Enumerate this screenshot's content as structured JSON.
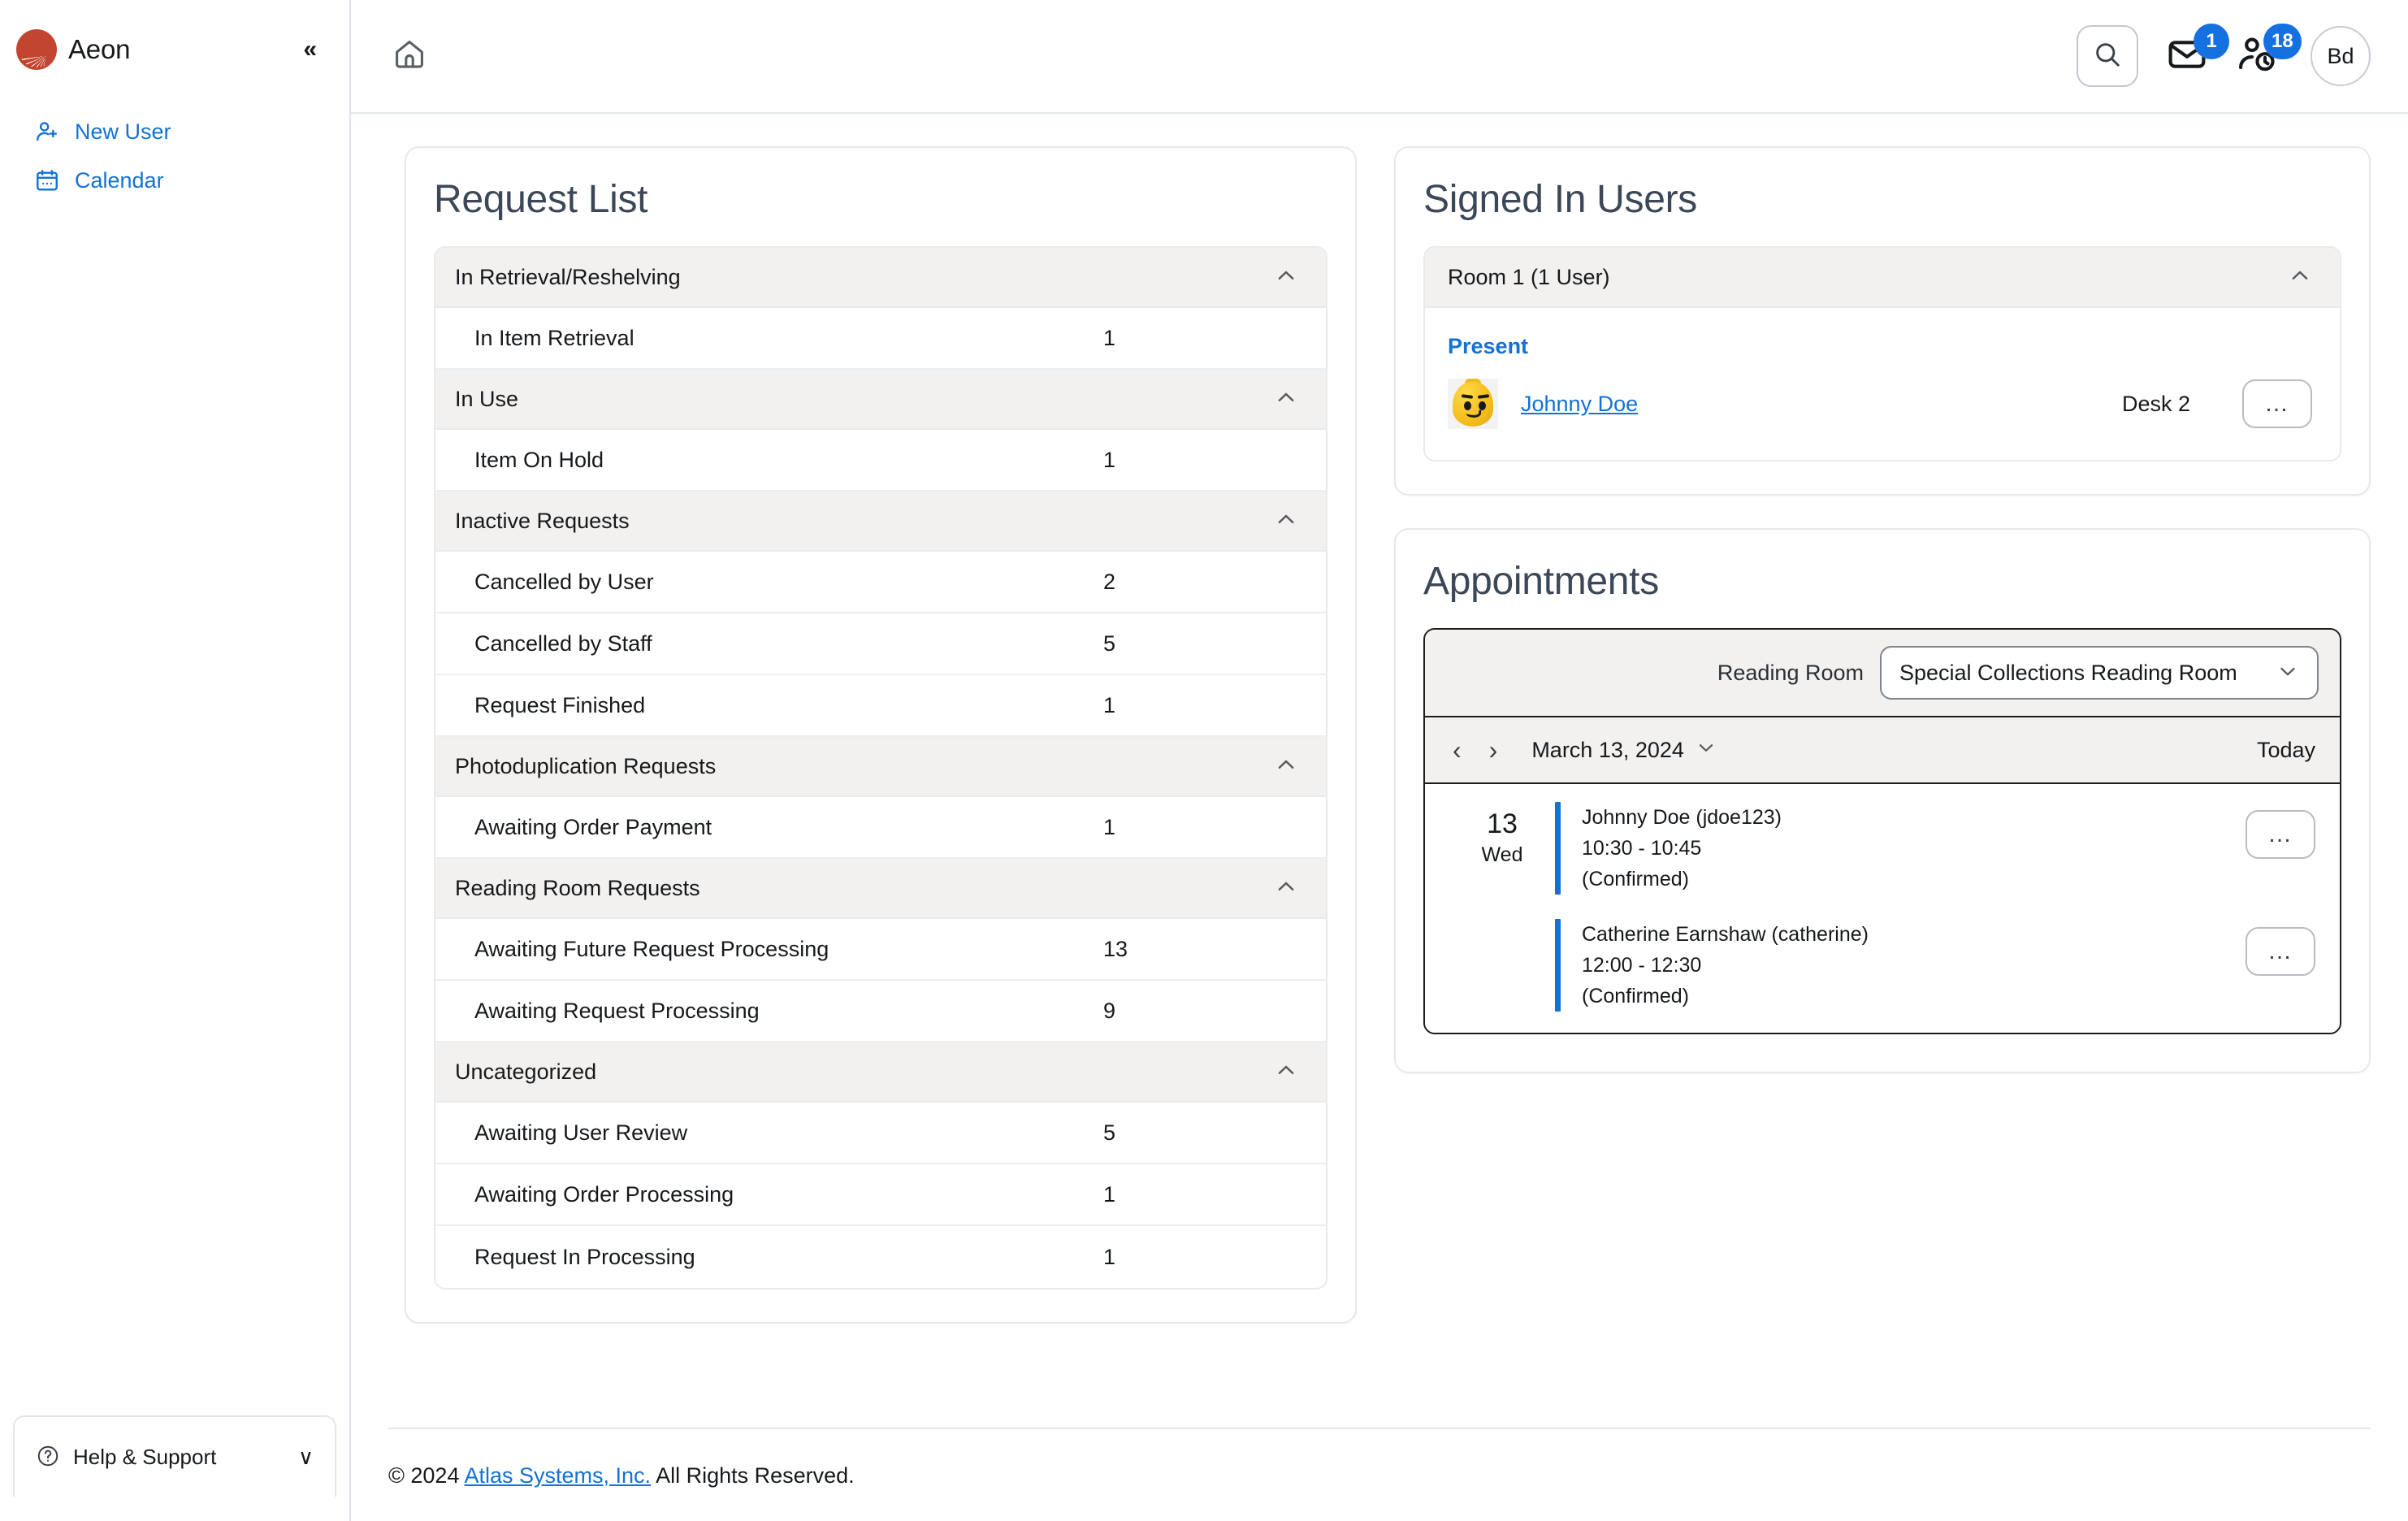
{
  "sidebar": {
    "brand": "Aeon",
    "collapse_label": "«",
    "items": [
      {
        "label": "New User",
        "icon": "user-plus-icon"
      },
      {
        "label": "Calendar",
        "icon": "calendar-icon"
      }
    ],
    "help": {
      "label": "Help & Support",
      "icon": "question-circle-icon",
      "chevron": "∨"
    }
  },
  "topbar": {
    "home_icon": "home-icon",
    "search_icon": "search-icon",
    "mail": {
      "icon": "mail-icon",
      "badge": "1"
    },
    "users_clock": {
      "icon": "users-clock-icon",
      "badge": "18"
    },
    "profile_initials": "Bd"
  },
  "request_list": {
    "title": "Request List",
    "groups": [
      {
        "title": "In Retrieval/Reshelving",
        "expanded": true,
        "rows": [
          {
            "label": "In Item Retrieval",
            "count": "1"
          }
        ]
      },
      {
        "title": "In Use",
        "expanded": true,
        "rows": [
          {
            "label": "Item On Hold",
            "count": "1"
          }
        ]
      },
      {
        "title": "Inactive Requests",
        "expanded": true,
        "rows": [
          {
            "label": "Cancelled by User",
            "count": "2"
          },
          {
            "label": "Cancelled by Staff",
            "count": "5"
          },
          {
            "label": "Request Finished",
            "count": "1"
          }
        ]
      },
      {
        "title": "Photoduplication Requests",
        "expanded": true,
        "rows": [
          {
            "label": "Awaiting Order Payment",
            "count": "1"
          }
        ]
      },
      {
        "title": "Reading Room Requests",
        "expanded": true,
        "rows": [
          {
            "label": "Awaiting Future Request Processing",
            "count": "13"
          },
          {
            "label": "Awaiting Request Processing",
            "count": "9"
          }
        ]
      },
      {
        "title": "Uncategorized",
        "expanded": true,
        "rows": [
          {
            "label": "Awaiting User Review",
            "count": "5"
          },
          {
            "label": "Awaiting Order Processing",
            "count": "1"
          },
          {
            "label": "Request In Processing",
            "count": "1"
          }
        ]
      }
    ]
  },
  "signed_in_users": {
    "title": "Signed In Users",
    "room": {
      "label": "Room 1 (1 User)",
      "expanded": true
    },
    "status": "Present",
    "users": [
      {
        "name": "Johnny Doe",
        "desk": "Desk 2",
        "avatar": "lego-head-avatar",
        "menu": "…"
      }
    ]
  },
  "appointments": {
    "title": "Appointments",
    "filter": {
      "label": "Reading Room",
      "selected": "Special Collections Reading Room"
    },
    "nav": {
      "prev": "‹",
      "next": "›",
      "date": "March 13, 2024",
      "date_chevron": "∨",
      "today": "Today"
    },
    "day": {
      "num": "13",
      "name": "Wed"
    },
    "items": [
      {
        "who": "Johnny Doe (jdoe123)",
        "time": "10:30 - 10:45",
        "status": "(Confirmed)",
        "menu": "…"
      },
      {
        "who": "Catherine Earnshaw (catherine)",
        "time": "12:00 - 12:30",
        "status": "(Confirmed)",
        "menu": "…"
      }
    ]
  },
  "footer": {
    "prefix": "© 2024 ",
    "link": "Atlas Systems, Inc.",
    "suffix": " All Rights Reserved."
  },
  "colors": {
    "accent_blue": "#1372d4",
    "badge_blue": "#1570e0",
    "brand_red": "#c1452f",
    "heading_slate": "#3c4858",
    "panel_gray": "#f2f1ef"
  }
}
